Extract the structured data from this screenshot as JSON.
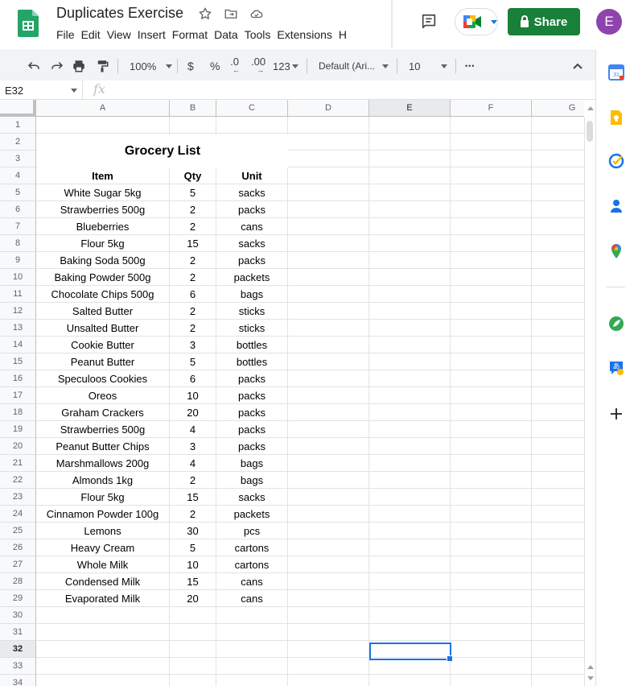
{
  "document": {
    "title": "Duplicates Exercise",
    "menu": [
      "File",
      "Edit",
      "View",
      "Insert",
      "Format",
      "Data",
      "Tools",
      "Extensions",
      "H"
    ],
    "share_label": "Share",
    "avatar_initial": "E"
  },
  "toolbar": {
    "zoom": "100%",
    "currency": "$",
    "percent": "%",
    "decrease_decimal": ".0",
    "increase_decimal": ".00",
    "number_format": "123",
    "font": "Default (Ari...",
    "font_size": "10",
    "more": "•••"
  },
  "formula_bar": {
    "name_box": "E32",
    "fx": "fx",
    "value": ""
  },
  "sheet": {
    "columns": [
      "A",
      "B",
      "C",
      "D",
      "E",
      "F",
      "G"
    ],
    "selected_column": "E",
    "selected_row": 32,
    "rows": [
      1,
      2,
      3,
      4,
      5,
      6,
      7,
      8,
      9,
      10,
      11,
      12,
      13,
      14,
      15,
      16,
      17,
      18,
      19,
      20,
      21,
      22,
      23,
      24,
      25,
      26,
      27,
      28,
      29,
      30,
      31,
      32,
      33,
      34
    ],
    "table_title": "Grocery List",
    "headers": [
      "Item",
      "Qty",
      "Unit"
    ],
    "items": [
      [
        "White Sugar 5kg",
        "5",
        "sacks"
      ],
      [
        "Strawberries 500g",
        "2",
        "packs"
      ],
      [
        "Blueberries",
        "2",
        "cans"
      ],
      [
        "Flour 5kg",
        "15",
        "sacks"
      ],
      [
        "Baking Soda 500g",
        "2",
        "packs"
      ],
      [
        "Baking Powder 500g",
        "2",
        "packets"
      ],
      [
        "Chocolate Chips 500g",
        "6",
        "bags"
      ],
      [
        "Salted Butter",
        "2",
        "sticks"
      ],
      [
        "Unsalted Butter",
        "2",
        "sticks"
      ],
      [
        "Cookie Butter",
        "3",
        "bottles"
      ],
      [
        "Peanut Butter",
        "5",
        "bottles"
      ],
      [
        "Speculoos Cookies",
        "6",
        "packs"
      ],
      [
        "Oreos",
        "10",
        "packs"
      ],
      [
        "Graham Crackers",
        "20",
        "packs"
      ],
      [
        "Strawberries 500g",
        "4",
        "packs"
      ],
      [
        "Peanut Butter Chips",
        "3",
        "packs"
      ],
      [
        "Marshmallows 200g",
        "4",
        "bags"
      ],
      [
        "Almonds 1kg",
        "2",
        "bags"
      ],
      [
        "Flour 5kg",
        "15",
        "sacks"
      ],
      [
        "Cinnamon Powder 100g",
        "2",
        "packets"
      ],
      [
        "Lemons",
        "30",
        "pcs"
      ],
      [
        "Heavy Cream",
        "5",
        "cartons"
      ],
      [
        "Whole Milk",
        "10",
        "cartons"
      ],
      [
        "Condensed Milk",
        "15",
        "cans"
      ],
      [
        "Evaporated Milk",
        "20",
        "cans"
      ]
    ]
  },
  "colors": {
    "share_green": "#188038",
    "selection_blue": "#1a73e8",
    "avatar_purple": "#8e44ad"
  }
}
